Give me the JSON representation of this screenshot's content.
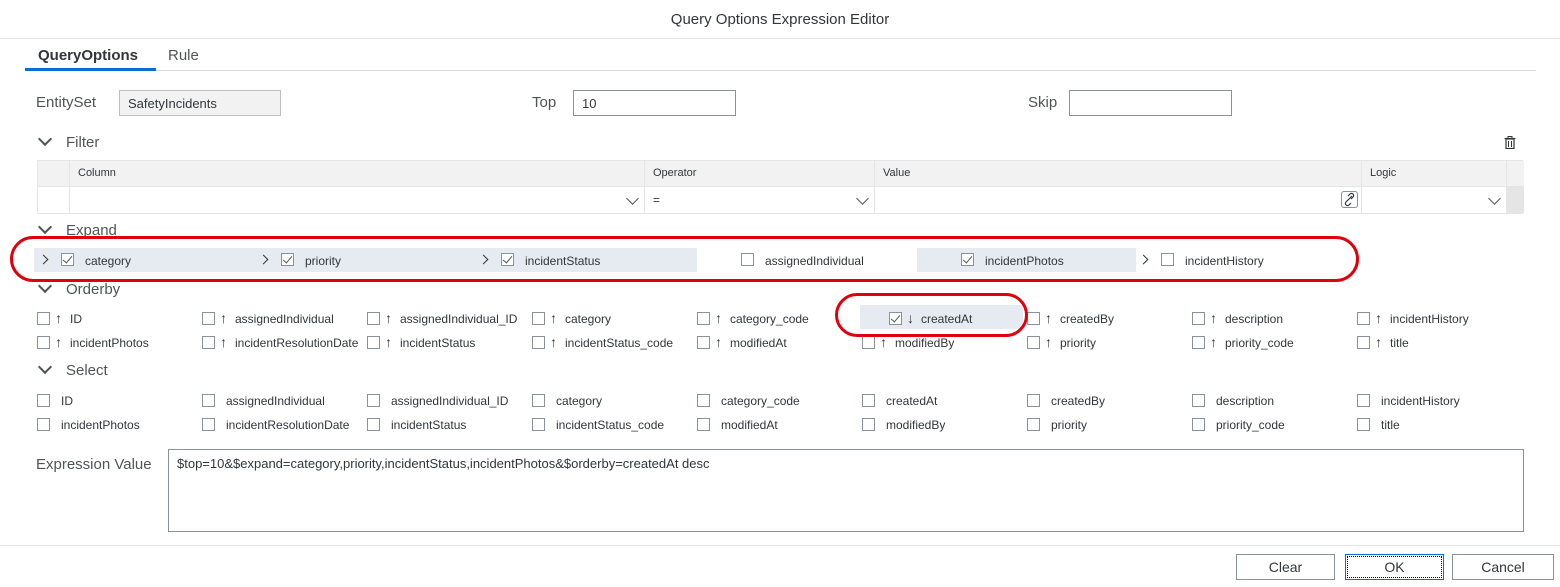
{
  "window": {
    "title": "Query Options Expression Editor"
  },
  "tabs": [
    {
      "label": "QueryOptions",
      "active": true
    },
    {
      "label": "Rule",
      "active": false
    }
  ],
  "fields": {
    "entityset_label": "EntitySet",
    "entityset_value": "SafetyIncidents",
    "top_label": "Top",
    "top_value": "10",
    "skip_label": "Skip",
    "skip_value": ""
  },
  "filter": {
    "title": "Filter",
    "columns": [
      "Column",
      "Operator",
      "Value",
      "Logic"
    ],
    "row": {
      "column": "",
      "operator": "=",
      "value": "",
      "logic": ""
    }
  },
  "expand": {
    "title": "Expand",
    "items": [
      {
        "label": "category",
        "checked": true,
        "expandable": true
      },
      {
        "label": "priority",
        "checked": true,
        "expandable": true
      },
      {
        "label": "incidentStatus",
        "checked": true,
        "expandable": true
      },
      {
        "label": "assignedIndividual",
        "checked": false,
        "expandable": false
      },
      {
        "label": "incidentPhotos",
        "checked": true,
        "expandable": false
      },
      {
        "label": "incidentHistory",
        "checked": false,
        "expandable": true
      }
    ]
  },
  "orderby": {
    "title": "Orderby",
    "items": [
      {
        "label": "ID",
        "checked": false,
        "dir": "asc"
      },
      {
        "label": "assignedIndividual",
        "checked": false,
        "dir": "asc"
      },
      {
        "label": "assignedIndividual_ID",
        "checked": false,
        "dir": "asc"
      },
      {
        "label": "category",
        "checked": false,
        "dir": "asc"
      },
      {
        "label": "category_code",
        "checked": false,
        "dir": "asc"
      },
      {
        "label": "createdAt",
        "checked": true,
        "dir": "desc"
      },
      {
        "label": "createdBy",
        "checked": false,
        "dir": "asc"
      },
      {
        "label": "description",
        "checked": false,
        "dir": "asc"
      },
      {
        "label": "incidentHistory",
        "checked": false,
        "dir": "asc"
      },
      {
        "label": "incidentPhotos",
        "checked": false,
        "dir": "asc"
      },
      {
        "label": "incidentResolutionDate",
        "checked": false,
        "dir": "asc"
      },
      {
        "label": "incidentStatus",
        "checked": false,
        "dir": "asc"
      },
      {
        "label": "incidentStatus_code",
        "checked": false,
        "dir": "asc"
      },
      {
        "label": "modifiedAt",
        "checked": false,
        "dir": "asc"
      },
      {
        "label": "modifiedBy",
        "checked": false,
        "dir": "asc"
      },
      {
        "label": "priority",
        "checked": false,
        "dir": "asc"
      },
      {
        "label": "priority_code",
        "checked": false,
        "dir": "asc"
      },
      {
        "label": "title",
        "checked": false,
        "dir": "asc"
      }
    ]
  },
  "select": {
    "title": "Select",
    "items": [
      {
        "label": "ID",
        "checked": false
      },
      {
        "label": "assignedIndividual",
        "checked": false
      },
      {
        "label": "assignedIndividual_ID",
        "checked": false
      },
      {
        "label": "category",
        "checked": false
      },
      {
        "label": "category_code",
        "checked": false
      },
      {
        "label": "createdAt",
        "checked": false
      },
      {
        "label": "createdBy",
        "checked": false
      },
      {
        "label": "description",
        "checked": false
      },
      {
        "label": "incidentHistory",
        "checked": false
      },
      {
        "label": "incidentPhotos",
        "checked": false
      },
      {
        "label": "incidentResolutionDate",
        "checked": false
      },
      {
        "label": "incidentStatus",
        "checked": false
      },
      {
        "label": "incidentStatus_code",
        "checked": false
      },
      {
        "label": "modifiedAt",
        "checked": false
      },
      {
        "label": "modifiedBy",
        "checked": false
      },
      {
        "label": "priority",
        "checked": false
      },
      {
        "label": "priority_code",
        "checked": false
      },
      {
        "label": "title",
        "checked": false
      }
    ]
  },
  "expression": {
    "label": "Expression Value",
    "value": "$top=10&$expand=category,priority,incidentStatus,incidentPhotos&$orderby=createdAt desc"
  },
  "buttons": {
    "clear": "Clear",
    "ok": "OK",
    "cancel": "Cancel"
  },
  "colors": {
    "accent": "#0a6ed1",
    "highlight": "#e0000b",
    "selected_bg": "#e5ebf1"
  }
}
